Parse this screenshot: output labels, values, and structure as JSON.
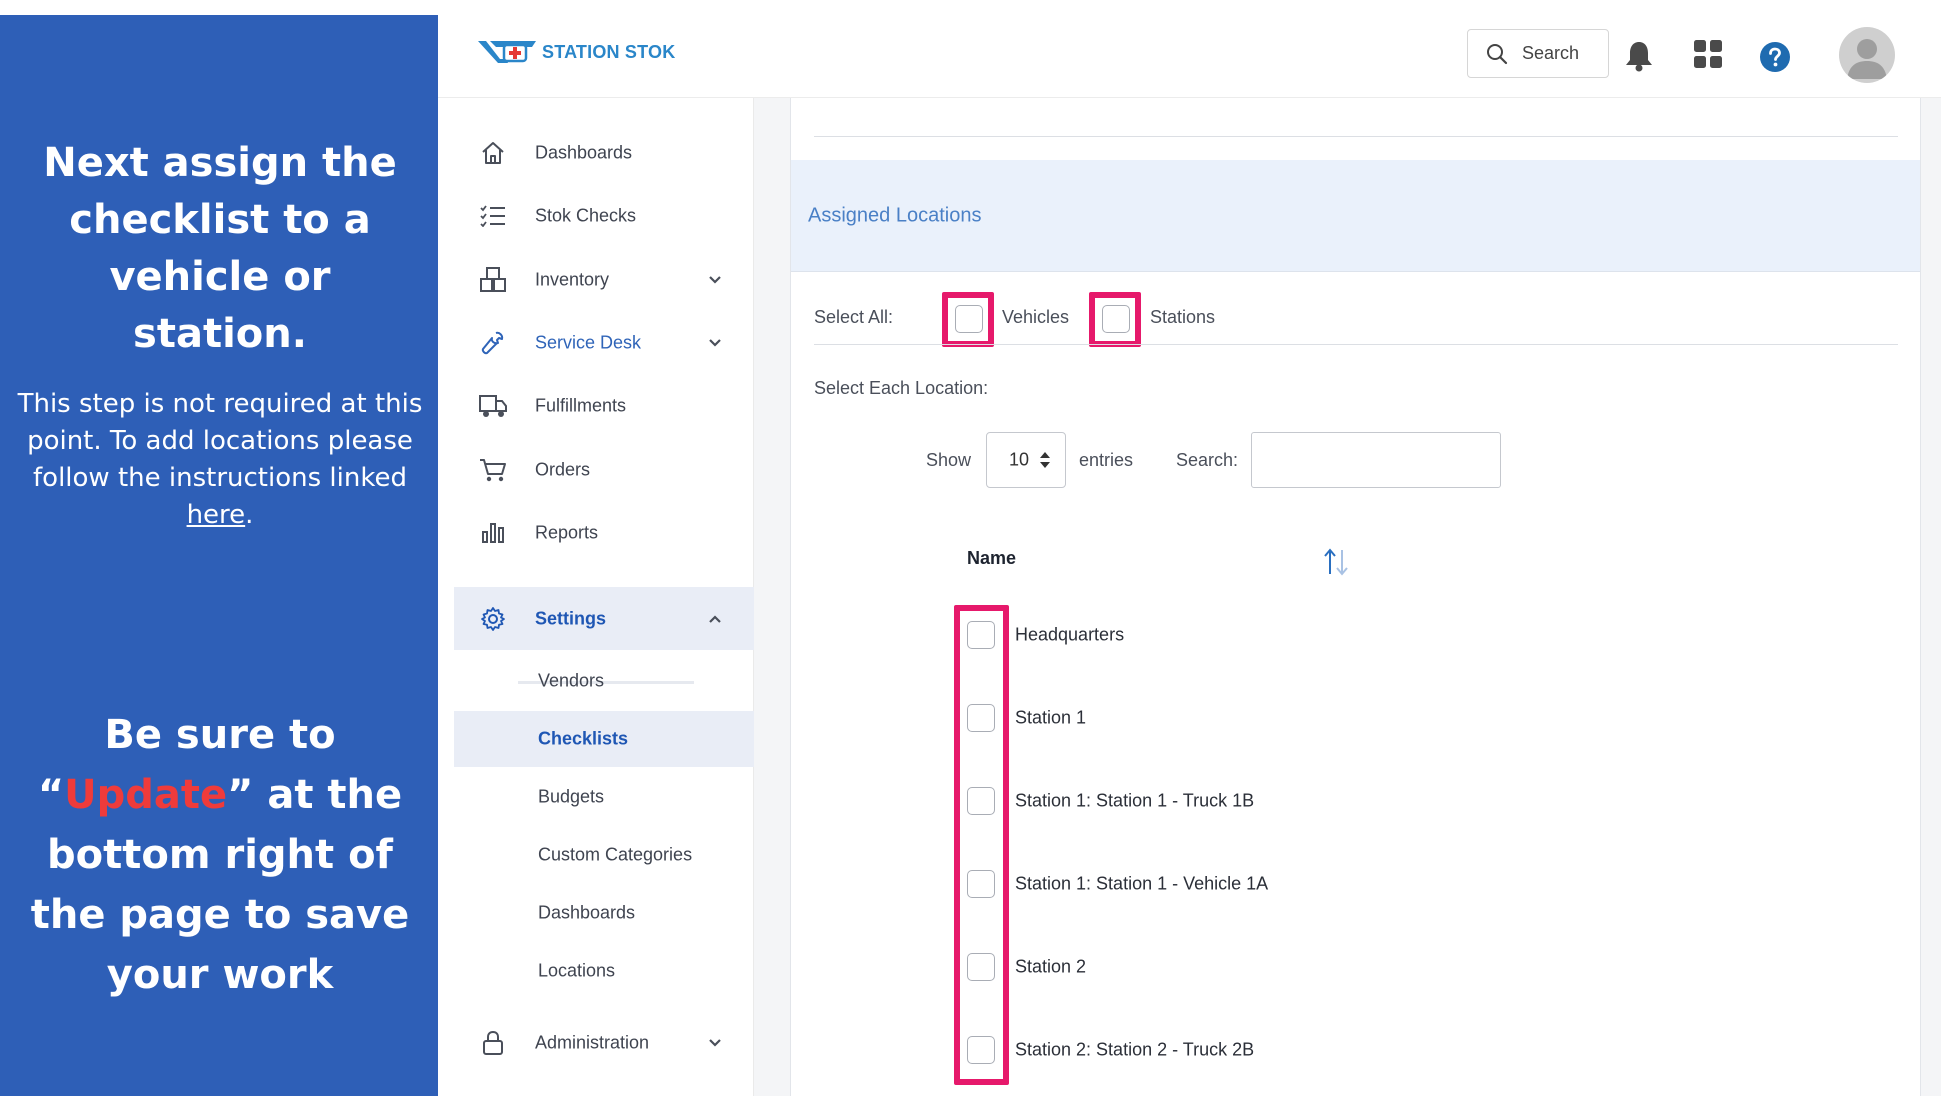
{
  "instructions": {
    "heading_1": "Next assign the checklist to a vehicle or station.",
    "note_text": "This step is not required at this point. To add locations please follow the instructions linked ",
    "note_link": "here",
    "note_end": ".",
    "heading_2_pre": "Be sure to “",
    "heading_2_accent": "Update",
    "heading_2_post": "” at the bottom right of the page to save your work",
    "accent_color": "#ef3b3b",
    "panel_color": "#2e5fb7"
  },
  "header": {
    "logo_text": "STATION STOK",
    "search_label": "Search"
  },
  "sidebar": {
    "items": [
      {
        "label": "Dashboards"
      },
      {
        "label": "Stok Checks"
      },
      {
        "label": "Inventory"
      },
      {
        "label": "Service Desk"
      },
      {
        "label": "Fulfillments"
      },
      {
        "label": "Orders"
      },
      {
        "label": "Reports"
      },
      {
        "label": "Settings"
      },
      {
        "label": "Administration"
      }
    ],
    "settings_sub": [
      {
        "label": "Vendors"
      },
      {
        "label": "Checklists"
      },
      {
        "label": "Budgets"
      },
      {
        "label": "Custom Categories"
      },
      {
        "label": "Dashboards"
      },
      {
        "label": "Locations"
      }
    ]
  },
  "main": {
    "section_title": "Assigned Locations",
    "select_all_label": "Select All:",
    "vehicles_label": "Vehicles",
    "stations_label": "Stations",
    "select_each_label": "Select Each Location:",
    "show_label": "Show",
    "entries_value": "10",
    "entries_label": "entries",
    "search_label": "Search:",
    "search_value": "",
    "table": {
      "column_header": "Name",
      "rows": [
        {
          "name": "Headquarters"
        },
        {
          "name": "Station 1"
        },
        {
          "name": "Station 1: Station 1 - Truck 1B"
        },
        {
          "name": "Station 1: Station 1 - Vehicle 1A"
        },
        {
          "name": "Station 2"
        },
        {
          "name": "Station 2: Station 2 - Truck 2B"
        }
      ]
    },
    "highlight_color": "#e6196b"
  }
}
